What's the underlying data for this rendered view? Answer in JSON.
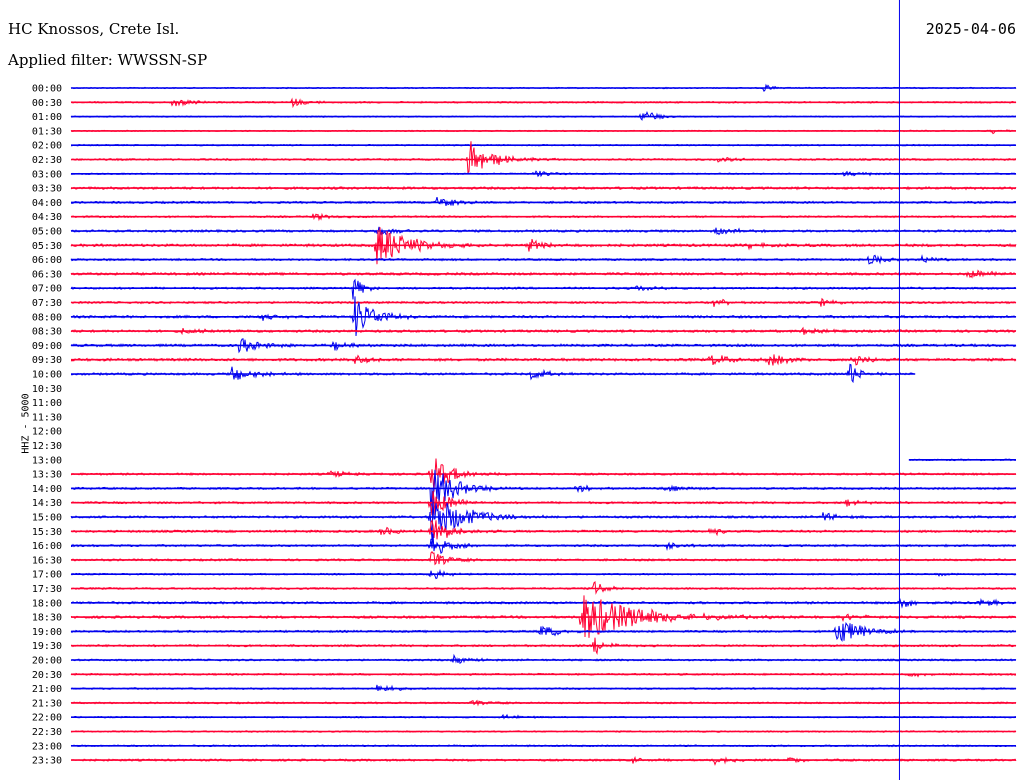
{
  "header": {
    "station": "HC Knossos, Crete Isl.",
    "filter": "Applied filter: WWSSN-SP",
    "date": "2025-04-06"
  },
  "chart_data": {
    "type": "line",
    "title": "HC Knossos, Crete Isl.",
    "ylabel": "HHZ - 5000",
    "date": "2025-04-06",
    "colors": {
      "a": "#0000ee",
      "b": "#ff0033",
      "cursor": "#0000ee"
    },
    "cursor_minute": 26.3,
    "rows": [
      {
        "label": "00:00",
        "color": "a",
        "start": 0,
        "end": 30,
        "noise": 0.6,
        "events": [
          {
            "t": 22.0,
            "amp": 4,
            "dur": 0.6
          }
        ]
      },
      {
        "label": "00:30",
        "color": "b",
        "start": 0,
        "end": 30,
        "noise": 0.8,
        "events": [
          {
            "t": 3.2,
            "amp": 5,
            "dur": 0.8
          },
          {
            "t": 7.0,
            "amp": 4,
            "dur": 1.0
          }
        ]
      },
      {
        "label": "01:00",
        "color": "a",
        "start": 0,
        "end": 30,
        "noise": 0.6,
        "events": [
          {
            "t": 18.1,
            "amp": 12,
            "dur": 0.5
          }
        ]
      },
      {
        "label": "01:30",
        "color": "b",
        "start": 0,
        "end": 30,
        "noise": 0.6,
        "events": [
          {
            "t": 29.2,
            "amp": 3,
            "dur": 0.6
          }
        ]
      },
      {
        "label": "02:00",
        "color": "a",
        "start": 0,
        "end": 30,
        "noise": 0.7,
        "events": []
      },
      {
        "label": "02:30",
        "color": "b",
        "start": 0,
        "end": 30,
        "noise": 0.9,
        "events": [
          {
            "t": 12.6,
            "amp": 20,
            "dur": 1.2
          },
          {
            "t": 20.5,
            "amp": 3,
            "dur": 1.0
          }
        ]
      },
      {
        "label": "03:00",
        "color": "a",
        "start": 0,
        "end": 30,
        "noise": 0.7,
        "events": [
          {
            "t": 14.7,
            "amp": 4,
            "dur": 0.8
          },
          {
            "t": 24.5,
            "amp": 3,
            "dur": 1.2
          }
        ]
      },
      {
        "label": "03:30",
        "color": "b",
        "start": 0,
        "end": 30,
        "noise": 1.2,
        "events": []
      },
      {
        "label": "04:00",
        "color": "a",
        "start": 0,
        "end": 30,
        "noise": 1.0,
        "events": [
          {
            "t": 11.6,
            "amp": 6,
            "dur": 1.0
          }
        ]
      },
      {
        "label": "04:30",
        "color": "b",
        "start": 0,
        "end": 30,
        "noise": 0.9,
        "events": [
          {
            "t": 7.6,
            "amp": 4,
            "dur": 0.8
          }
        ]
      },
      {
        "label": "05:00",
        "color": "a",
        "start": 0,
        "end": 30,
        "noise": 1.1,
        "events": [
          {
            "t": 9.7,
            "amp": 6,
            "dur": 0.8
          },
          {
            "t": 20.4,
            "amp": 5,
            "dur": 1.0
          }
        ]
      },
      {
        "label": "05:30",
        "color": "b",
        "start": 0,
        "end": 30,
        "noise": 1.3,
        "events": [
          {
            "t": 9.7,
            "amp": 24,
            "dur": 1.5
          },
          {
            "t": 14.5,
            "amp": 7,
            "dur": 1.0
          },
          {
            "t": 21.5,
            "amp": 3,
            "dur": 0.8
          }
        ]
      },
      {
        "label": "06:00",
        "color": "a",
        "start": 0,
        "end": 30,
        "noise": 1.0,
        "events": [
          {
            "t": 25.3,
            "amp": 6,
            "dur": 0.8
          },
          {
            "t": 27.0,
            "amp": 4,
            "dur": 0.8
          }
        ]
      },
      {
        "label": "06:30",
        "color": "b",
        "start": 0,
        "end": 30,
        "noise": 1.2,
        "events": [
          {
            "t": 28.4,
            "amp": 5,
            "dur": 1.4
          }
        ]
      },
      {
        "label": "07:00",
        "color": "a",
        "start": 0,
        "end": 30,
        "noise": 1.0,
        "events": [
          {
            "t": 8.9,
            "amp": 14,
            "dur": 0.5
          },
          {
            "t": 17.9,
            "amp": 4,
            "dur": 0.8
          }
        ]
      },
      {
        "label": "07:30",
        "color": "b",
        "start": 0,
        "end": 30,
        "noise": 1.0,
        "events": [
          {
            "t": 20.4,
            "amp": 4,
            "dur": 0.8
          },
          {
            "t": 23.8,
            "amp": 4,
            "dur": 0.8
          }
        ]
      },
      {
        "label": "08:00",
        "color": "a",
        "start": 0,
        "end": 30,
        "noise": 1.2,
        "events": [
          {
            "t": 9.0,
            "amp": 22,
            "dur": 1.0
          },
          {
            "t": 6.0,
            "amp": 4,
            "dur": 0.8
          }
        ]
      },
      {
        "label": "08:30",
        "color": "b",
        "start": 0,
        "end": 30,
        "noise": 1.2,
        "events": [
          {
            "t": 3.5,
            "amp": 4,
            "dur": 0.8
          },
          {
            "t": 23.2,
            "amp": 4,
            "dur": 0.8
          }
        ]
      },
      {
        "label": "09:00",
        "color": "a",
        "start": 0,
        "end": 30,
        "noise": 1.2,
        "events": [
          {
            "t": 5.3,
            "amp": 8,
            "dur": 1.2
          },
          {
            "t": 8.3,
            "amp": 5,
            "dur": 0.8
          }
        ]
      },
      {
        "label": "09:30",
        "color": "b",
        "start": 0,
        "end": 30,
        "noise": 1.3,
        "events": [
          {
            "t": 9.0,
            "amp": 8,
            "dur": 0.6
          },
          {
            "t": 20.3,
            "amp": 6,
            "dur": 1.0
          },
          {
            "t": 22.1,
            "amp": 8,
            "dur": 0.8
          },
          {
            "t": 24.8,
            "amp": 8,
            "dur": 0.6
          }
        ]
      },
      {
        "label": "10:00",
        "color": "a",
        "start": 0,
        "end": 26.8,
        "noise": 1.1,
        "events": [
          {
            "t": 5.1,
            "amp": 9,
            "dur": 1.0
          },
          {
            "t": 14.6,
            "amp": 6,
            "dur": 0.8
          },
          {
            "t": 24.7,
            "amp": 14,
            "dur": 0.5
          }
        ]
      },
      {
        "label": "10:30",
        "color": "b",
        "start": 0,
        "end": 0,
        "noise": 0,
        "events": []
      },
      {
        "label": "11:00",
        "color": "a",
        "start": 0,
        "end": 0,
        "noise": 0,
        "events": []
      },
      {
        "label": "11:30",
        "color": "b",
        "start": 0,
        "end": 0,
        "noise": 0,
        "events": []
      },
      {
        "label": "12:00",
        "color": "a",
        "start": 0,
        "end": 0,
        "noise": 0,
        "events": []
      },
      {
        "label": "12:30",
        "color": "b",
        "start": 0,
        "end": 0,
        "noise": 0,
        "events": []
      },
      {
        "label": "13:00",
        "color": "a",
        "start": 26.6,
        "end": 30,
        "noise": 0.8,
        "events": []
      },
      {
        "label": "13:30",
        "color": "b",
        "start": 0,
        "end": 30,
        "noise": 1.0,
        "events": [
          {
            "t": 11.4,
            "amp": 22,
            "dur": 1.0
          },
          {
            "t": 8.2,
            "amp": 4,
            "dur": 0.8
          }
        ]
      },
      {
        "label": "14:00",
        "color": "a",
        "start": 0,
        "end": 30,
        "noise": 1.0,
        "events": [
          {
            "t": 11.4,
            "amp": 26,
            "dur": 1.2
          },
          {
            "t": 16.0,
            "amp": 4,
            "dur": 0.8
          },
          {
            "t": 18.8,
            "amp": 4,
            "dur": 0.8
          }
        ]
      },
      {
        "label": "14:30",
        "color": "b",
        "start": 0,
        "end": 30,
        "noise": 1.0,
        "events": [
          {
            "t": 11.4,
            "amp": 16,
            "dur": 1.0
          },
          {
            "t": 24.6,
            "amp": 4,
            "dur": 0.8
          }
        ]
      },
      {
        "label": "15:00",
        "color": "a",
        "start": 0,
        "end": 30,
        "noise": 1.1,
        "events": [
          {
            "t": 11.4,
            "amp": 26,
            "dur": 1.6
          },
          {
            "t": 23.8,
            "amp": 6,
            "dur": 0.8
          }
        ]
      },
      {
        "label": "15:30",
        "color": "b",
        "start": 0,
        "end": 30,
        "noise": 1.1,
        "events": [
          {
            "t": 11.4,
            "amp": 14,
            "dur": 1.0
          },
          {
            "t": 9.8,
            "amp": 5,
            "dur": 1.2
          },
          {
            "t": 20.3,
            "amp": 4,
            "dur": 0.8
          }
        ]
      },
      {
        "label": "16:00",
        "color": "a",
        "start": 0,
        "end": 30,
        "noise": 1.0,
        "events": [
          {
            "t": 11.4,
            "amp": 14,
            "dur": 0.8
          },
          {
            "t": 18.9,
            "amp": 4,
            "dur": 0.8
          }
        ]
      },
      {
        "label": "16:30",
        "color": "b",
        "start": 0,
        "end": 30,
        "noise": 1.0,
        "events": [
          {
            "t": 11.4,
            "amp": 10,
            "dur": 0.8
          }
        ]
      },
      {
        "label": "17:00",
        "color": "a",
        "start": 0,
        "end": 30,
        "noise": 0.8,
        "events": [
          {
            "t": 11.4,
            "amp": 8,
            "dur": 0.6
          },
          {
            "t": 27.6,
            "amp": 5,
            "dur": 0.3
          }
        ]
      },
      {
        "label": "17:30",
        "color": "b",
        "start": 0,
        "end": 30,
        "noise": 0.9,
        "events": [
          {
            "t": 16.6,
            "amp": 8,
            "dur": 0.6
          }
        ]
      },
      {
        "label": "18:00",
        "color": "a",
        "start": 0,
        "end": 30,
        "noise": 1.1,
        "events": [
          {
            "t": 26.3,
            "amp": 6,
            "dur": 0.8
          },
          {
            "t": 28.8,
            "amp": 4,
            "dur": 1.0
          }
        ]
      },
      {
        "label": "18:30",
        "color": "b",
        "start": 0,
        "end": 30,
        "noise": 1.2,
        "events": [
          {
            "t": 16.2,
            "amp": 26,
            "dur": 2.8
          },
          {
            "t": 24.5,
            "amp": 4,
            "dur": 0.8
          }
        ]
      },
      {
        "label": "19:00",
        "color": "a",
        "start": 0,
        "end": 30,
        "noise": 1.0,
        "events": [
          {
            "t": 14.9,
            "amp": 8,
            "dur": 0.8
          },
          {
            "t": 24.3,
            "amp": 16,
            "dur": 1.2
          }
        ]
      },
      {
        "label": "19:30",
        "color": "b",
        "start": 0,
        "end": 30,
        "noise": 1.0,
        "events": [
          {
            "t": 16.6,
            "amp": 10,
            "dur": 0.6
          }
        ]
      },
      {
        "label": "20:00",
        "color": "a",
        "start": 0,
        "end": 30,
        "noise": 0.9,
        "events": [
          {
            "t": 12.1,
            "amp": 6,
            "dur": 0.8
          }
        ]
      },
      {
        "label": "20:30",
        "color": "b",
        "start": 0,
        "end": 30,
        "noise": 0.9,
        "events": [
          {
            "t": 26.6,
            "amp": 3,
            "dur": 0.6
          }
        ]
      },
      {
        "label": "21:00",
        "color": "a",
        "start": 0,
        "end": 30,
        "noise": 0.8,
        "events": [
          {
            "t": 9.7,
            "amp": 5,
            "dur": 0.8
          }
        ]
      },
      {
        "label": "21:30",
        "color": "b",
        "start": 0,
        "end": 30,
        "noise": 0.8,
        "events": [
          {
            "t": 12.7,
            "amp": 3,
            "dur": 1.0
          }
        ]
      },
      {
        "label": "22:00",
        "color": "a",
        "start": 0,
        "end": 30,
        "noise": 0.7,
        "events": [
          {
            "t": 13.7,
            "amp": 3,
            "dur": 0.8
          }
        ]
      },
      {
        "label": "22:30",
        "color": "b",
        "start": 0,
        "end": 30,
        "noise": 0.7,
        "events": []
      },
      {
        "label": "23:00",
        "color": "a",
        "start": 0,
        "end": 30,
        "noise": 0.8,
        "events": []
      },
      {
        "label": "23:30",
        "color": "b",
        "start": 0,
        "end": 30,
        "noise": 1.0,
        "events": [
          {
            "t": 20.4,
            "amp": 5,
            "dur": 1.0
          },
          {
            "t": 22.8,
            "amp": 4,
            "dur": 0.8
          },
          {
            "t": 17.8,
            "amp": 3,
            "dur": 0.6
          }
        ]
      }
    ]
  }
}
